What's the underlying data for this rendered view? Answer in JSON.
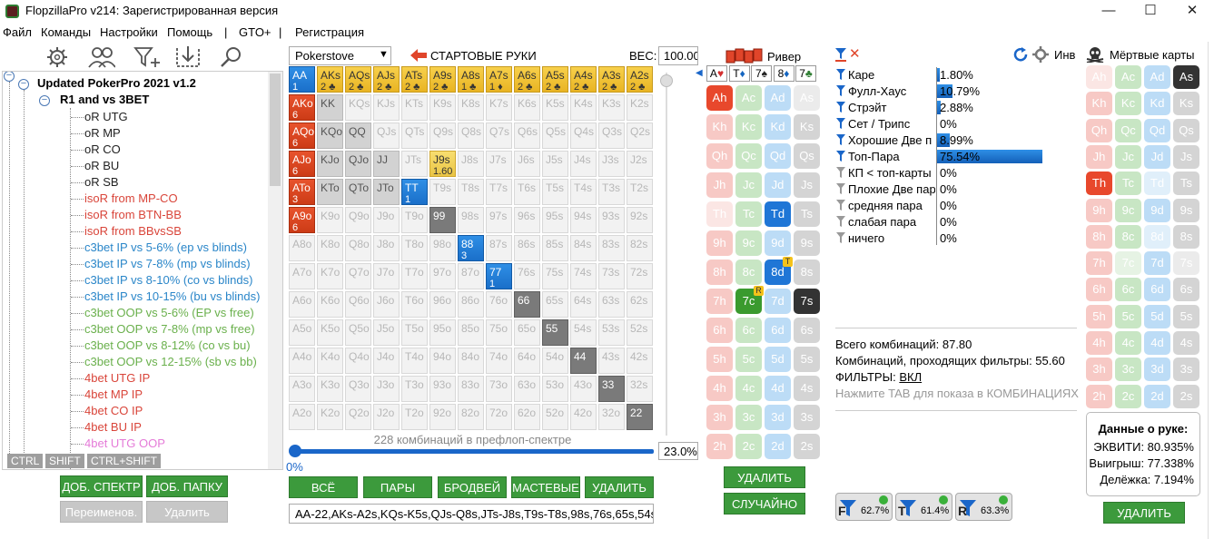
{
  "window": {
    "title": "FlopzillaPro v214: Зарегистрированная версия"
  },
  "menu": [
    "Файл",
    "Команды",
    "Настройки",
    "Помощь",
    "|",
    "GTO+",
    "|",
    "Регистрация"
  ],
  "tree": {
    "root": "Updated PokerPro 2021 v1.2",
    "folder": "R1 and vs 3BET",
    "items": [
      {
        "label": "oR UTG",
        "color": "#222222"
      },
      {
        "label": "oR MP",
        "color": "#222222"
      },
      {
        "label": "oR CO",
        "color": "#222222"
      },
      {
        "label": "oR BU",
        "color": "#222222"
      },
      {
        "label": "oR SB",
        "color": "#222222"
      },
      {
        "label": "isoR from MP-CO",
        "color": "#d9453a"
      },
      {
        "label": "isoR from BTN-BB",
        "color": "#d9453a"
      },
      {
        "label": "isoR from BBvsSB",
        "color": "#d9453a"
      },
      {
        "label": "c3bet IP vs 5-6% (ep vs blinds)",
        "color": "#2a86c9"
      },
      {
        "label": "c3bet IP vs 7-8% (mp vs blinds)",
        "color": "#2a86c9"
      },
      {
        "label": "c3bet IP vs 8-10% (co vs blinds)",
        "color": "#2a86c9"
      },
      {
        "label": "c3bet IP vs 10-15% (bu vs blinds)",
        "color": "#2a86c9"
      },
      {
        "label": "c3bet OOP vs 5-6% (EP vs free)",
        "color": "#6ab04c"
      },
      {
        "label": "c3bet OOP vs 7-8% (mp vs free)",
        "color": "#6ab04c"
      },
      {
        "label": "c3bet OOP vs 8-12% (co vs bu)",
        "color": "#6ab04c"
      },
      {
        "label": "c3bet OOP vs 12-15% (sb vs bb)",
        "color": "#6ab04c"
      },
      {
        "label": "4bet UTG IP",
        "color": "#d9453a"
      },
      {
        "label": "4bet MP IP",
        "color": "#d9453a"
      },
      {
        "label": "4bet CO IP",
        "color": "#d9453a"
      },
      {
        "label": "4bet BU IP",
        "color": "#d9453a"
      },
      {
        "label": "4bet UTG OOP",
        "color": "#e57bd8"
      }
    ]
  },
  "keys": {
    "ctrl": "CTRL",
    "shift": "SHIFT",
    "ctrlshift": "CTRL+SHIFT"
  },
  "left_buttons": {
    "add_range": "ДОБ. СПЕКТР",
    "add_folder": "ДОБ. ПАПКУ",
    "rename": "Переименов.",
    "delete": "Удалить"
  },
  "range": {
    "dropdown": "Pokerstove",
    "title": "СТАРТОВЫЕ РУКИ",
    "weight_label": "ВЕС:",
    "weight_value": "100.00",
    "combos_text": "228 комбинаций в префлоп-спектре",
    "slider_left": "0%",
    "slider_right": "23.0%",
    "buttons": [
      "ВСЁ",
      "ПАРЫ",
      "БРОДВЕЙ",
      "МАСТЕВЫЕ",
      "УДАЛИТЬ"
    ],
    "text": "AA-22,AKs-A2s,KQs-K5s,QJs-Q8s,JTs-J8s,T9s-T8s,98s,76s,65s,54s,A"
  },
  "grid": [
    [
      "AA|1|b",
      "AKs|2 ♣|y",
      "AQs|2 ♣|y",
      "AJs|2 ♣|y",
      "ATs|2 ♣|y",
      "A9s|2 ♣|y",
      "A8s|1 ♣|y",
      "A7s|1 ♦|y",
      "A6s|2 ♣|y",
      "A5s|2 ♣|y",
      "A4s|2 ♣|y",
      "A3s|2 ♣|y",
      "A2s|2 ♣|y"
    ],
    [
      "AKo|6|r",
      "KK||lg",
      "KQs||",
      "KJs||",
      "KTs||",
      "K9s||",
      "K8s||",
      "K7s||",
      "K6s||",
      "K5s||",
      "K4s||",
      "K3s||",
      "K2s||"
    ],
    [
      "AQo|6|r",
      "KQo||lg",
      "QQ||lg",
      "QJs||",
      "QTs||",
      "Q9s||",
      "Q8s||",
      "Q7s||",
      "Q6s||",
      "Q5s||",
      "Q4s||",
      "Q3s||",
      "Q2s||"
    ],
    [
      "AJo|6|r",
      "KJo||lg",
      "QJo||lg",
      "JJ||lg",
      "JTs||",
      "J9s|1.60|yl",
      "J8s||",
      "J7s||",
      "J6s||",
      "J5s||",
      "J4s||",
      "J3s||",
      "J2s||"
    ],
    [
      "ATo|3|r",
      "KTo||lg",
      "QTo||lg",
      "JTo||lg",
      "TT|1|b",
      "T9s||",
      "T8s||",
      "T7s||",
      "T6s||",
      "T5s||",
      "T4s||",
      "T3s||",
      "T2s||"
    ],
    [
      "A9o|6|r",
      "K9o||",
      "Q9o||",
      "J9o||",
      "T9o||",
      "99||g",
      "98s||",
      "97s||",
      "96s||",
      "95s||",
      "94s||",
      "93s||",
      "92s||"
    ],
    [
      "A8o||",
      "K8o||",
      "Q8o||",
      "J8o||",
      "T8o||",
      "98o||",
      "88|3|b",
      "87s||",
      "86s||",
      "85s||",
      "84s||",
      "83s||",
      "82s||"
    ],
    [
      "A7o||",
      "K7o||",
      "Q7o||",
      "J7o||",
      "T7o||",
      "97o||",
      "87o||",
      "77|1|b",
      "76s||",
      "75s||",
      "74s||",
      "73s||",
      "72s||"
    ],
    [
      "A6o||",
      "K6o||",
      "Q6o||",
      "J6o||",
      "T6o||",
      "96o||",
      "86o||",
      "76o||",
      "66||g",
      "65s||",
      "64s||",
      "63s||",
      "62s||"
    ],
    [
      "A5o||",
      "K5o||",
      "Q5o||",
      "J5o||",
      "T5o||",
      "95o||",
      "85o||",
      "75o||",
      "65o||",
      "55||g",
      "54s||",
      "53s||",
      "52s||"
    ],
    [
      "A4o||",
      "K4o||",
      "Q4o||",
      "J4o||",
      "T4o||",
      "94o||",
      "84o||",
      "74o||",
      "64o||",
      "54o||",
      "44||g",
      "43s||",
      "42s||"
    ],
    [
      "A3o||",
      "K3o||",
      "Q3o||",
      "J3o||",
      "T3o||",
      "93o||",
      "83o||",
      "73o||",
      "63o||",
      "53o||",
      "43o||",
      "33||g",
      "32s||"
    ],
    [
      "A2o||",
      "K2o||",
      "Q2o||",
      "J2o||",
      "T2o||",
      "92o||",
      "82o||",
      "72o||",
      "62o||",
      "52o||",
      "42o||",
      "32o||",
      "22||g"
    ]
  ],
  "board": {
    "title": "Ривер",
    "slots": [
      {
        "label": "A",
        "suit": "♥",
        "color": "#d32f2f"
      },
      {
        "label": "T",
        "suit": "♦",
        "color": "#1565c0"
      },
      {
        "label": "7",
        "suit": "♠",
        "color": "#222222"
      },
      {
        "label": "8",
        "suit": "♦",
        "color": "#1565c0"
      },
      {
        "label": "7",
        "suit": "♣",
        "color": "#2e7d32"
      }
    ],
    "delete": "УДАЛИТЬ",
    "random": "СЛУЧАЙНО"
  },
  "ranks": [
    "A",
    "K",
    "Q",
    "J",
    "T",
    "9",
    "8",
    "7",
    "6",
    "5",
    "4",
    "3",
    "2"
  ],
  "stats": {
    "rows": [
      {
        "label": "Каре",
        "pct": "1.80%",
        "val": 1.8,
        "active": true
      },
      {
        "label": "Фулл-Хаус",
        "pct": "10.79%",
        "val": 10.79,
        "active": true
      },
      {
        "label": "Стрэйт",
        "pct": "2.88%",
        "val": 2.88,
        "active": true
      },
      {
        "label": "Сет / Трипс",
        "pct": "0%",
        "val": 0,
        "active": true
      },
      {
        "label": "Хорошие Две п",
        "pct": "8.99%",
        "val": 8.99,
        "active": true
      },
      {
        "label": "Топ-Пара",
        "pct": "75.54%",
        "val": 75.54,
        "active": true
      },
      {
        "label": "КП < топ-карты",
        "pct": "0%",
        "val": 0,
        "active": false
      },
      {
        "label": "Плохие Две пар",
        "pct": "0%",
        "val": 0,
        "active": false
      },
      {
        "label": "средняя пара",
        "pct": "0%",
        "val": 0,
        "active": false
      },
      {
        "label": "слабая пара",
        "pct": "0%",
        "val": 0,
        "active": false
      },
      {
        "label": "ничего",
        "pct": "0%",
        "val": 0,
        "active": false
      }
    ],
    "inv": "Инв",
    "total": "Всего комбинаций: 87.80",
    "passing": "Комбинаций, проходящих фильтры: 55.60",
    "filters_label": "ФИЛЬТРЫ:",
    "filters_value": "ВКЛ",
    "hint": "Нажмите TAB для показа в КОМБИНАЦИЯХ",
    "chips": [
      {
        "letter": "F",
        "pct": "62.7%"
      },
      {
        "letter": "T",
        "pct": "61.4%"
      },
      {
        "letter": "R",
        "pct": "63.3%"
      }
    ]
  },
  "dead": {
    "title": "Мёртвые карты",
    "hand_title": "Данные о руке:",
    "equity": "ЭКВИТИ: 80.935%",
    "win": "Выигрыш: 77.338%",
    "tie": "Делёжка: 7.194%",
    "delete": "УДАЛИТЬ"
  }
}
